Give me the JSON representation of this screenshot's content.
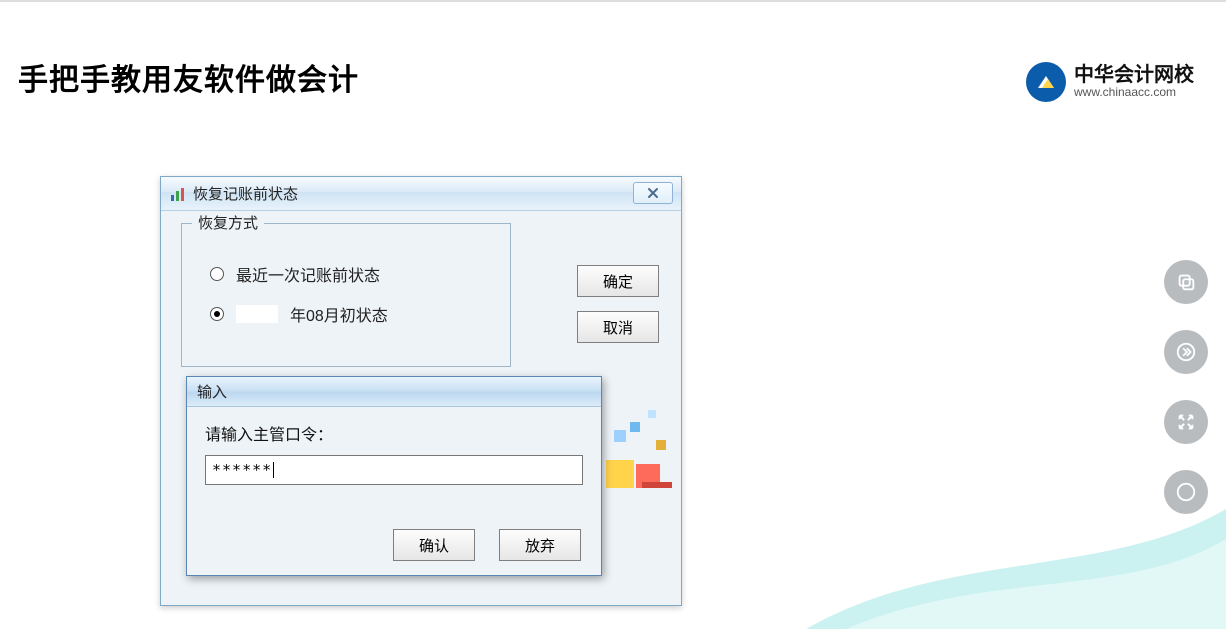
{
  "page": {
    "title": "手把手教用友软件做会计"
  },
  "brand": {
    "name": "中华会计网校",
    "url": "www.chinaacc.com"
  },
  "dialog_restore": {
    "title": "恢复记账前状态",
    "group_label": "恢复方式",
    "option_recent": "最近一次记账前状态",
    "option_month_suffix": "年08月初状态",
    "ok": "确定",
    "cancel": "取消"
  },
  "dialog_input": {
    "title": "输入",
    "prompt": "请输入主管口令：",
    "value": "******",
    "confirm": "确认",
    "abandon": "放弃"
  }
}
